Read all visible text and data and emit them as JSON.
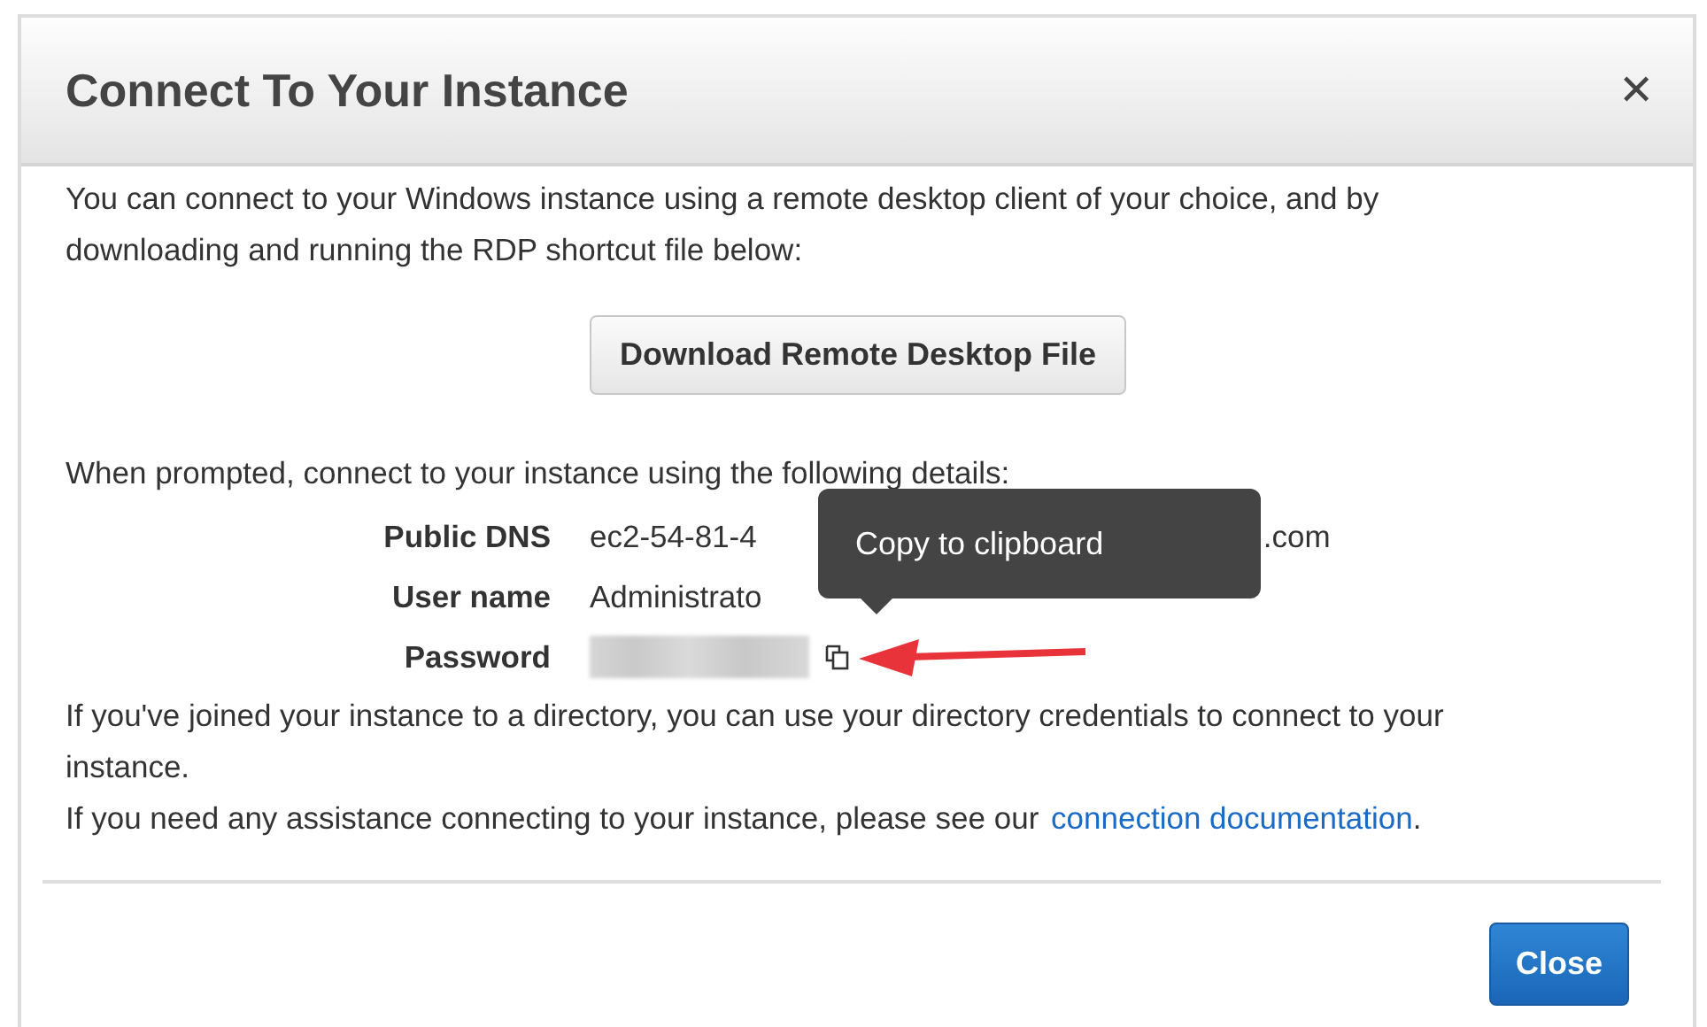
{
  "dialog": {
    "title": "Connect To Your Instance",
    "close_icon": "✕"
  },
  "intro": "You can connect to your Windows instance using a remote desktop client of your choice, and by downloading and running the RDP shortcut file below:",
  "download_button": "Download Remote Desktop File",
  "prompt": "When prompted, connect to your instance using the following details:",
  "details": [
    {
      "kind": "split",
      "label": "Public DNS",
      "value": "ec2-54-81-4",
      "value_end": ".com"
    },
    {
      "kind": "text",
      "label": "User name",
      "value": "Administrato"
    },
    {
      "kind": "secret",
      "label": "Password"
    }
  ],
  "tooltip": "Copy to clipboard",
  "directory_note": "If you've joined your instance to a directory, you can use your directory credentials to connect to your instance.",
  "help": {
    "text": "If you need any assistance connecting to your instance, please see our",
    "link": "connection documentation",
    "end": "."
  },
  "footer_button": "Close"
}
